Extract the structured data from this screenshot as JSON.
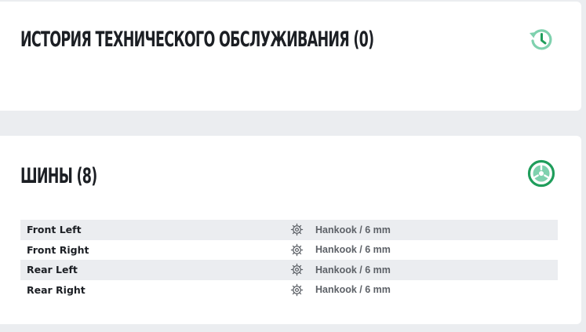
{
  "history": {
    "title": "ИСТОРИЯ ТЕХНИЧЕСКОГО ОБСЛУЖИВАНИЯ (0)",
    "icon": "history-icon",
    "icon_color": "#7fd1ae"
  },
  "tires": {
    "title": "ШИНЫ (8)",
    "icon": "wheel-icon",
    "icon_color": "#1f9d5b",
    "rows": [
      {
        "position": "Front Left",
        "value": "Hankook / 6 mm",
        "icon": "tire-gear-icon"
      },
      {
        "position": "Front Right",
        "value": "Hankook / 6 mm",
        "icon": "tire-gear-icon"
      },
      {
        "position": "Rear Left",
        "value": "Hankook / 6 mm",
        "icon": "tire-gear-icon"
      },
      {
        "position": "Rear Right",
        "value": "Hankook / 6 mm",
        "icon": "tire-gear-icon"
      }
    ]
  },
  "colors": {
    "background": "#ebedf0",
    "card": "#ffffff",
    "text_primary": "#1c1f24",
    "text_secondary": "#5d6167",
    "row_shade": "#ebedf0"
  }
}
